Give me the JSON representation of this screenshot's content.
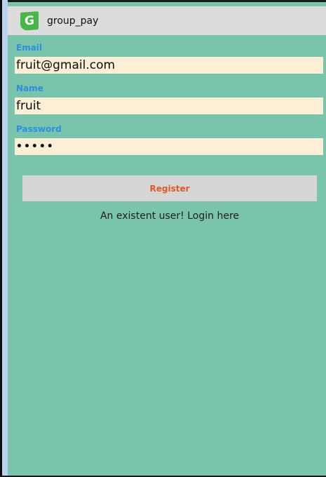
{
  "app_bar": {
    "icon_letter": "G",
    "title": "group_pay"
  },
  "form": {
    "email": {
      "label": "Email",
      "value": "fruit@gmail.com"
    },
    "name": {
      "label": "Name",
      "value": "fruit"
    },
    "password": {
      "label": "Password",
      "masked_value": "•••••"
    },
    "register_button": "Register",
    "login_link": "An existent user! Login here"
  },
  "colors": {
    "background": "#7ac4ae",
    "action_bar": "#dcdcdc",
    "label": "#2a8fe0",
    "input_bg": "#fdeed6",
    "button_bg": "#d6d6d6",
    "button_text": "#e2572a",
    "app_icon": "#49b64a"
  },
  "icons": {
    "app_icon": "app-logo-icon"
  }
}
